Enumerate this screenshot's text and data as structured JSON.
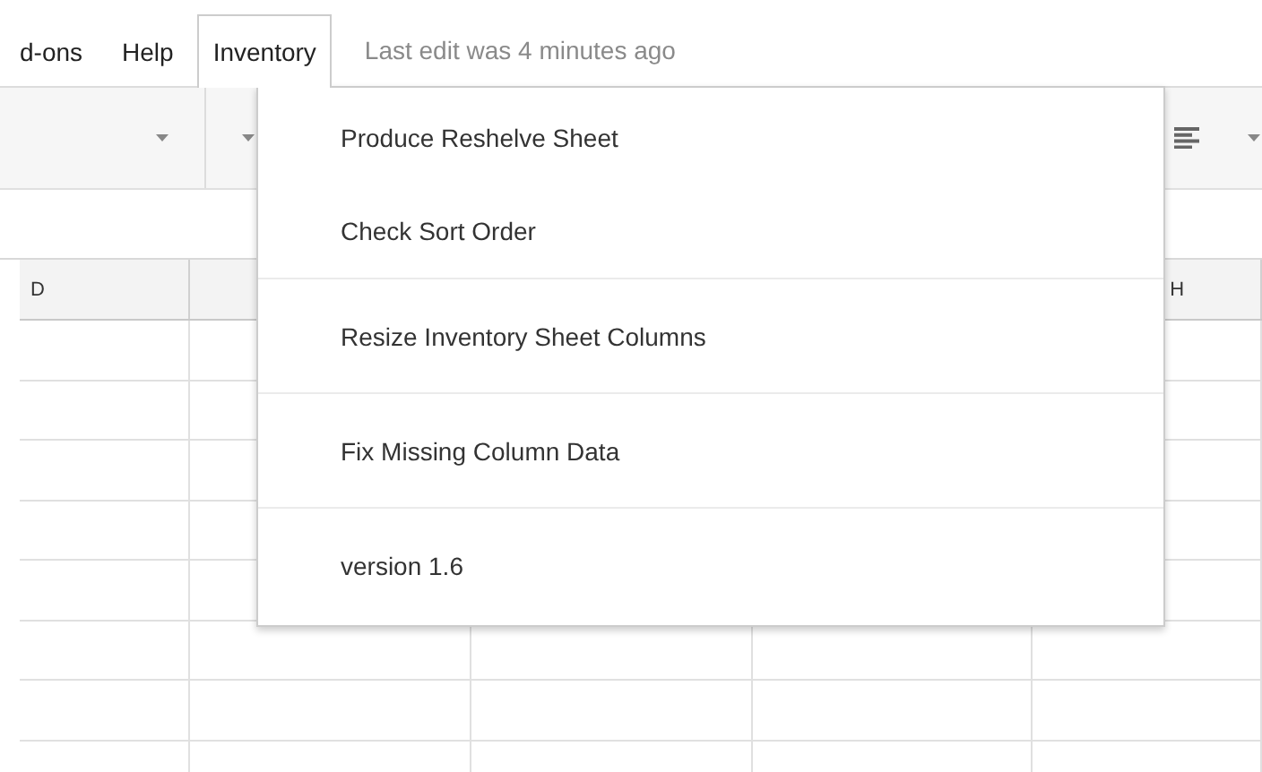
{
  "menubar": [
    {
      "label": "d-ons",
      "selected": false
    },
    {
      "label": "Help",
      "selected": false
    },
    {
      "label": "Inventory",
      "selected": true
    }
  ],
  "status": "Last edit was 4 minutes ago",
  "sheet": {
    "column_headers": [
      "D",
      "H"
    ]
  },
  "menu": {
    "sections": [
      [
        "Produce Reshelve Sheet",
        "Check Sort Order"
      ],
      [
        "Resize Inventory Sheet Columns"
      ],
      [
        "Fix Missing Column Data"
      ],
      [
        "version 1.6"
      ]
    ]
  }
}
